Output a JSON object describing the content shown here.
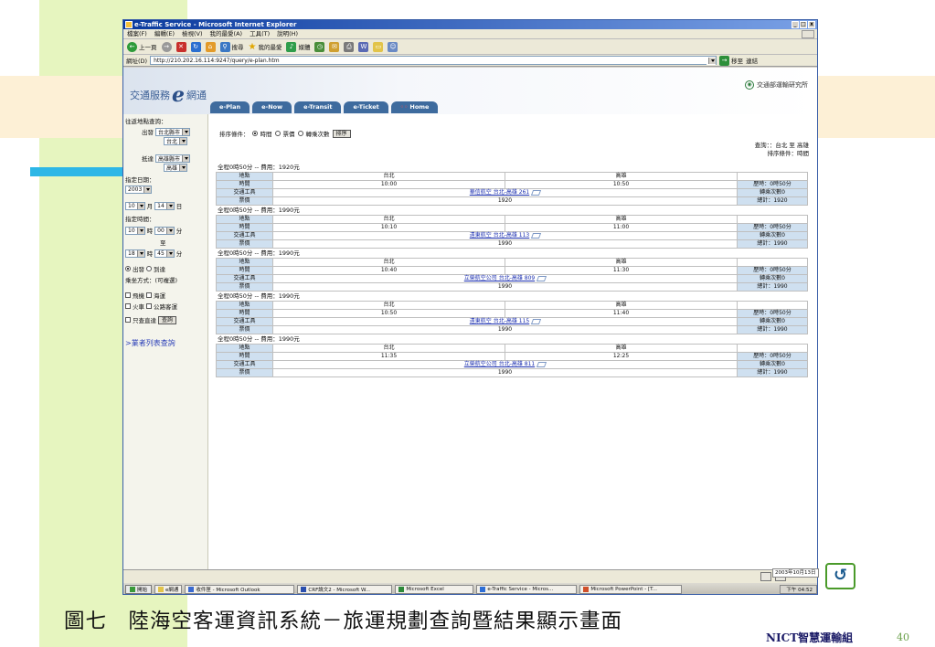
{
  "browser": {
    "title": "e-Traffic Service - Microsoft Internet Explorer",
    "window_buttons": [
      "_",
      "□",
      "x"
    ],
    "menu": [
      "檔案(F)",
      "編輯(E)",
      "檢視(V)",
      "我的最愛(A)",
      "工具(T)",
      "說明(H)"
    ],
    "toolbar": {
      "back": "上一頁",
      "search": "搜尋",
      "favorites": "我的最愛",
      "media": "媒體"
    },
    "address_label": "網址(D)",
    "url": "http://210.202.16.114:9247/query/e-plan.htm",
    "go_label": "移至",
    "links_label": "連結"
  },
  "site": {
    "logo_text": "交通服務",
    "logo_e": "e",
    "logo_suffix": "網通",
    "agency": "交通部運輸研究所",
    "tabs": [
      {
        "label": "e-Plan"
      },
      {
        "label": "e-Now"
      },
      {
        "label": "e-Transit"
      },
      {
        "label": "e-Ticket"
      },
      {
        "label": "Home",
        "prefix": "◦◦"
      }
    ]
  },
  "sidebar": {
    "title": "往返地點查詢：",
    "depart_label": "出發",
    "depart_city": "台北縣市",
    "depart_station": "台北",
    "arrive_label": "抵達",
    "arrive_city": "高雄縣市",
    "arrive_station": "高雄",
    "date_label": "指定日期：",
    "year": "2003",
    "month": "10",
    "month_unit": "月",
    "day": "14",
    "day_unit": "日",
    "time_label": "指定時間：",
    "from_hour": "10",
    "from_min": "00",
    "hour_unit": "時",
    "min_unit": "分",
    "to_label": "至",
    "to_hour": "18",
    "to_min": "45",
    "opt_depart": "出發",
    "opt_arrive": "到達",
    "mode_label": "乘坐方式：(可複選)",
    "mode_air": "飛機",
    "mode_sea": "海運",
    "mode_rail": "火車",
    "mode_bus": "公路客運",
    "direct_only": "只查直達",
    "query_btn": "查詢",
    "operator_link": ">業者列表查詢"
  },
  "main": {
    "sort_label": "排序條件：",
    "sort_time": "時間",
    "sort_price": "票價",
    "sort_transfers": "轉乘次數",
    "sort_btn": "排序",
    "query_line1": "查詢：：台北 至 高雄",
    "query_line2": "排序條件：時間",
    "row_labels": {
      "place": "地點",
      "time": "時間",
      "transport": "交通工具",
      "fare": "票價"
    },
    "itineraries": [
      {
        "header": "全程0時50分 -- 費用：1920元",
        "from": "台北",
        "to": "高雄",
        "dep": "10:00",
        "arr": "10:50",
        "flight": "華信航空 台北-高雄 261",
        "fare": "1920",
        "duration": "歷時：0時50分",
        "transfers": "轉乘次數0",
        "total": "總計：1920"
      },
      {
        "header": "全程0時50分 -- 費用：1990元",
        "from": "台北",
        "to": "高雄",
        "dep": "10:10",
        "arr": "11:00",
        "flight": "遠東航空 台北-高雄 113",
        "fare": "1990",
        "duration": "歷時：0時50分",
        "transfers": "轉乘次數0",
        "total": "總計：1990"
      },
      {
        "header": "全程0時50分 -- 費用：1990元",
        "from": "台北",
        "to": "高雄",
        "dep": "10:40",
        "arr": "11:30",
        "flight": "立榮航空公司 台北-高雄 809",
        "fare": "1990",
        "duration": "歷時：0時50分",
        "transfers": "轉乘次數0",
        "total": "總計：1990"
      },
      {
        "header": "全程0時50分 -- 費用：1990元",
        "from": "台北",
        "to": "高雄",
        "dep": "10:50",
        "arr": "11:40",
        "flight": "遠東航空 台北-高雄 115",
        "fare": "1990",
        "duration": "歷時：0時50分",
        "transfers": "轉乘次數0",
        "total": "總計：1990"
      },
      {
        "header": "全程0時50分 -- 費用：1990元",
        "from": "台北",
        "to": "高雄",
        "dep": "11:35",
        "arr": "12:25",
        "flight": "立榮航空公司 台北-高雄 811",
        "fare": "1990",
        "duration": "歷時：0時50分",
        "transfers": "轉乘次數0",
        "total": "總計：1990"
      }
    ]
  },
  "taskbar": {
    "start": "開始",
    "quicklaunch": "e網通",
    "tasks": [
      "收件匣 - Microsoft Outlook",
      "CRF論文2 - Microsoft W...",
      "Microsoft Excel",
      "e-Traffic Service - Micros...",
      "Microsoft PowerPoint - [T..."
    ],
    "clock": "下午 04:52",
    "date": "2003年10月13日"
  },
  "slide": {
    "caption": "圖七　陸海空客運資訊系統－旅運規劃查詢暨結果顯示畫面",
    "footer": "NICT智慧運輸組",
    "page": "40"
  }
}
